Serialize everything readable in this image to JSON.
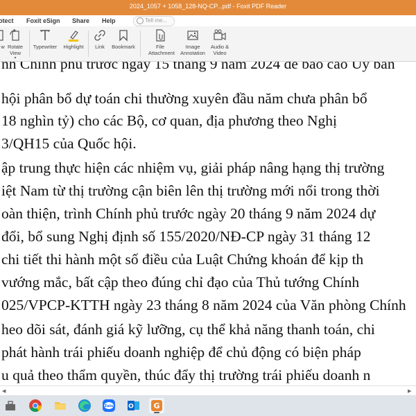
{
  "window": {
    "title": "2024_1057 + 1058_128-NQ-CP...pdf - Foxit PDF Reader"
  },
  "menu": {
    "items": [
      "otect",
      "Foxit eSign",
      "Share",
      "Help"
    ],
    "search_placeholder": "Tell me..."
  },
  "ribbon": {
    "tools": [
      {
        "label": "w",
        "icon": "view-icon"
      },
      {
        "label": "Rotate View",
        "icon": "rotate-view-icon"
      },
      {
        "label": "Typewriter",
        "icon": "typewriter-icon"
      },
      {
        "label": "Highlight",
        "icon": "highlight-icon"
      },
      {
        "label": "Link",
        "icon": "link-icon"
      },
      {
        "label": "Bookmark",
        "icon": "bookmark-icon"
      },
      {
        "label": "File Attachment",
        "icon": "file-attachment-icon"
      },
      {
        "label": "Image Annotation",
        "icon": "image-annotation-icon"
      },
      {
        "label": "Audio & Video",
        "icon": "audio-video-icon"
      }
    ]
  },
  "document": {
    "lines": [
      "nh Chính phủ trước ngày 15 tháng 9 năm 2024 để báo cáo Ủy ban",
      " hội phân bổ dự toán chi thường xuyên đầu năm chưa phân bổ",
      "18 nghìn tỷ) cho các Bộ, cơ quan, địa phương theo Nghị",
      "3/QH15 của Quốc hội.",
      "ập trung thực hiện các nhiệm vụ, giải pháp nâng hạng thị trường",
      "iệt Nam từ thị trường cận biên lên thị trường mới nổi trong thời",
      "oàn thiện, trình Chính phủ trước ngày 20 tháng 9 năm 2024 dự",
      " đổi, bổ sung Nghị định số 155/2020/NĐ-CP ngày 31 tháng 12",
      " chi tiết thi hành một số điều của Luật Chứng khoán để kịp th",
      "vướng mắc, bất cập theo đúng chỉ đạo của Thủ tướng Chính",
      "025/VPCP-KTTH ngày 23 tháng 8 năm 2024 của Văn phòng Chính",
      "heo dõi sát, đánh giá kỹ lưỡng, cụ thể khả năng thanh toán, chi",
      "phát hành trái phiếu doanh nghiệp để chủ động có biện pháp",
      "u quả theo thẩm quyền, thúc đẩy thị trường trái phiếu doanh n"
    ]
  },
  "scrollbar": {
    "left_arrow": "◀",
    "right_arrow": "▶"
  },
  "taskbar": {
    "apps": [
      {
        "name": "file-explorer-icon"
      },
      {
        "name": "chrome-icon"
      },
      {
        "name": "folder-icon"
      },
      {
        "name": "edge-icon"
      },
      {
        "name": "zalo-icon",
        "label": "Zalo"
      },
      {
        "name": "outlook-icon",
        "label": "O"
      },
      {
        "name": "foxit-icon",
        "label": "G"
      }
    ]
  },
  "colors": {
    "titlebar": "#e38a3a",
    "foxit": "#e8852f",
    "zalo": "#1e73ff",
    "outlook": "#0a64c8"
  }
}
